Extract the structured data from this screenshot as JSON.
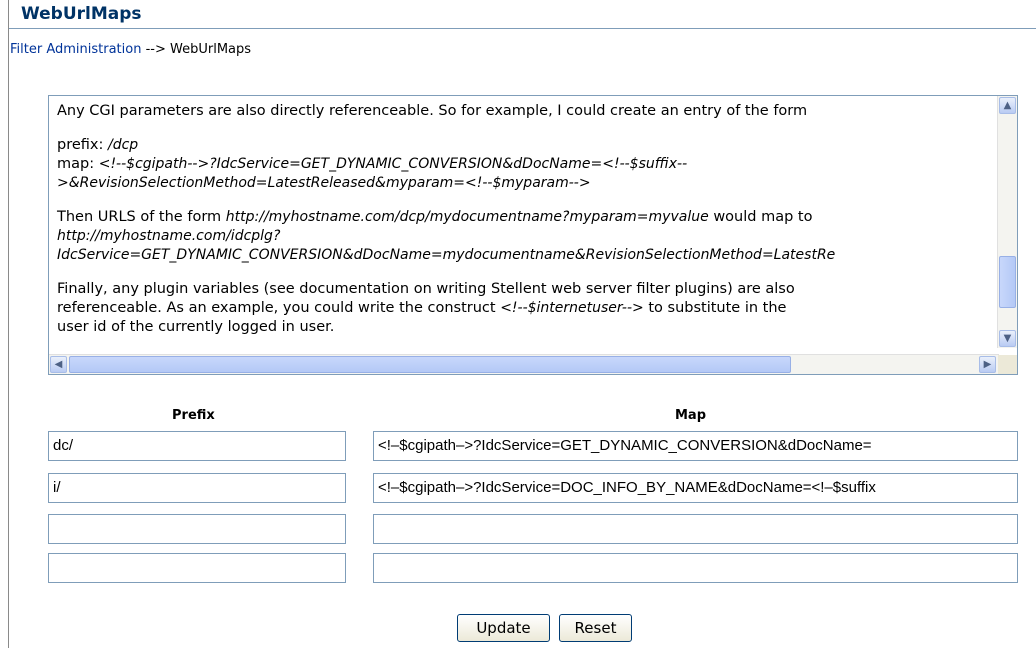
{
  "header": {
    "title": "WebUrlMaps"
  },
  "breadcrumb": {
    "link": "Filter Administration",
    "separator": " --> ",
    "current": "WebUrlMaps"
  },
  "help": {
    "p1": "Any CGI parameters are also directly referenceable. So for example, I could create an entry of the form",
    "prefix_label": "prefix: ",
    "prefix_value": "/dcp",
    "map_label": "map: ",
    "map_line1": "<!--$cgipath-->?IdcService=GET_DYNAMIC_CONVERSION&dDocName=<!--$suffix--",
    "map_line2": ">&RevisionSelectionMethod=LatestReleased&myparam=<!--$myparam-->",
    "p3_start": "Then URLS of the form ",
    "p3_url1": "http://myhostname.com/dcp/mydocumentname?myparam=myvalue",
    "p3_mid": " would map to",
    "p3_url2_line1": "http://myhostname.com/idcplg?",
    "p3_url2_line2": "IdcService=GET_DYNAMIC_CONVERSION&dDocName=mydocumentname&RevisionSelectionMethod=LatestRe",
    "p4_line1": "Finally, any plugin variables (see documentation on writing Stellent web server filter plugins) are also",
    "p4_line2_start": "referenceable. As an example, you could write the construct ",
    "p4_construct": "<!--$internetuser-->",
    "p4_line2_end": " to substitute in the",
    "p4_line3": "user id of the currently logged in user."
  },
  "scroll_icons": {
    "up": "▲",
    "down": "▼",
    "left": "◀",
    "right": "▶"
  },
  "table": {
    "prefix_header": "Prefix",
    "map_header": "Map",
    "rows": [
      {
        "prefix": "dc/",
        "map": "<!–$cgipath–>?IdcService=GET_DYNAMIC_CONVERSION&dDocName="
      },
      {
        "prefix": "i/",
        "map": "<!–$cgipath–>?IdcService=DOC_INFO_BY_NAME&dDocName=<!–$suffix"
      },
      {
        "prefix": "",
        "map": ""
      },
      {
        "prefix": "",
        "map": ""
      }
    ]
  },
  "buttons": {
    "update": "Update",
    "reset": "Reset"
  }
}
